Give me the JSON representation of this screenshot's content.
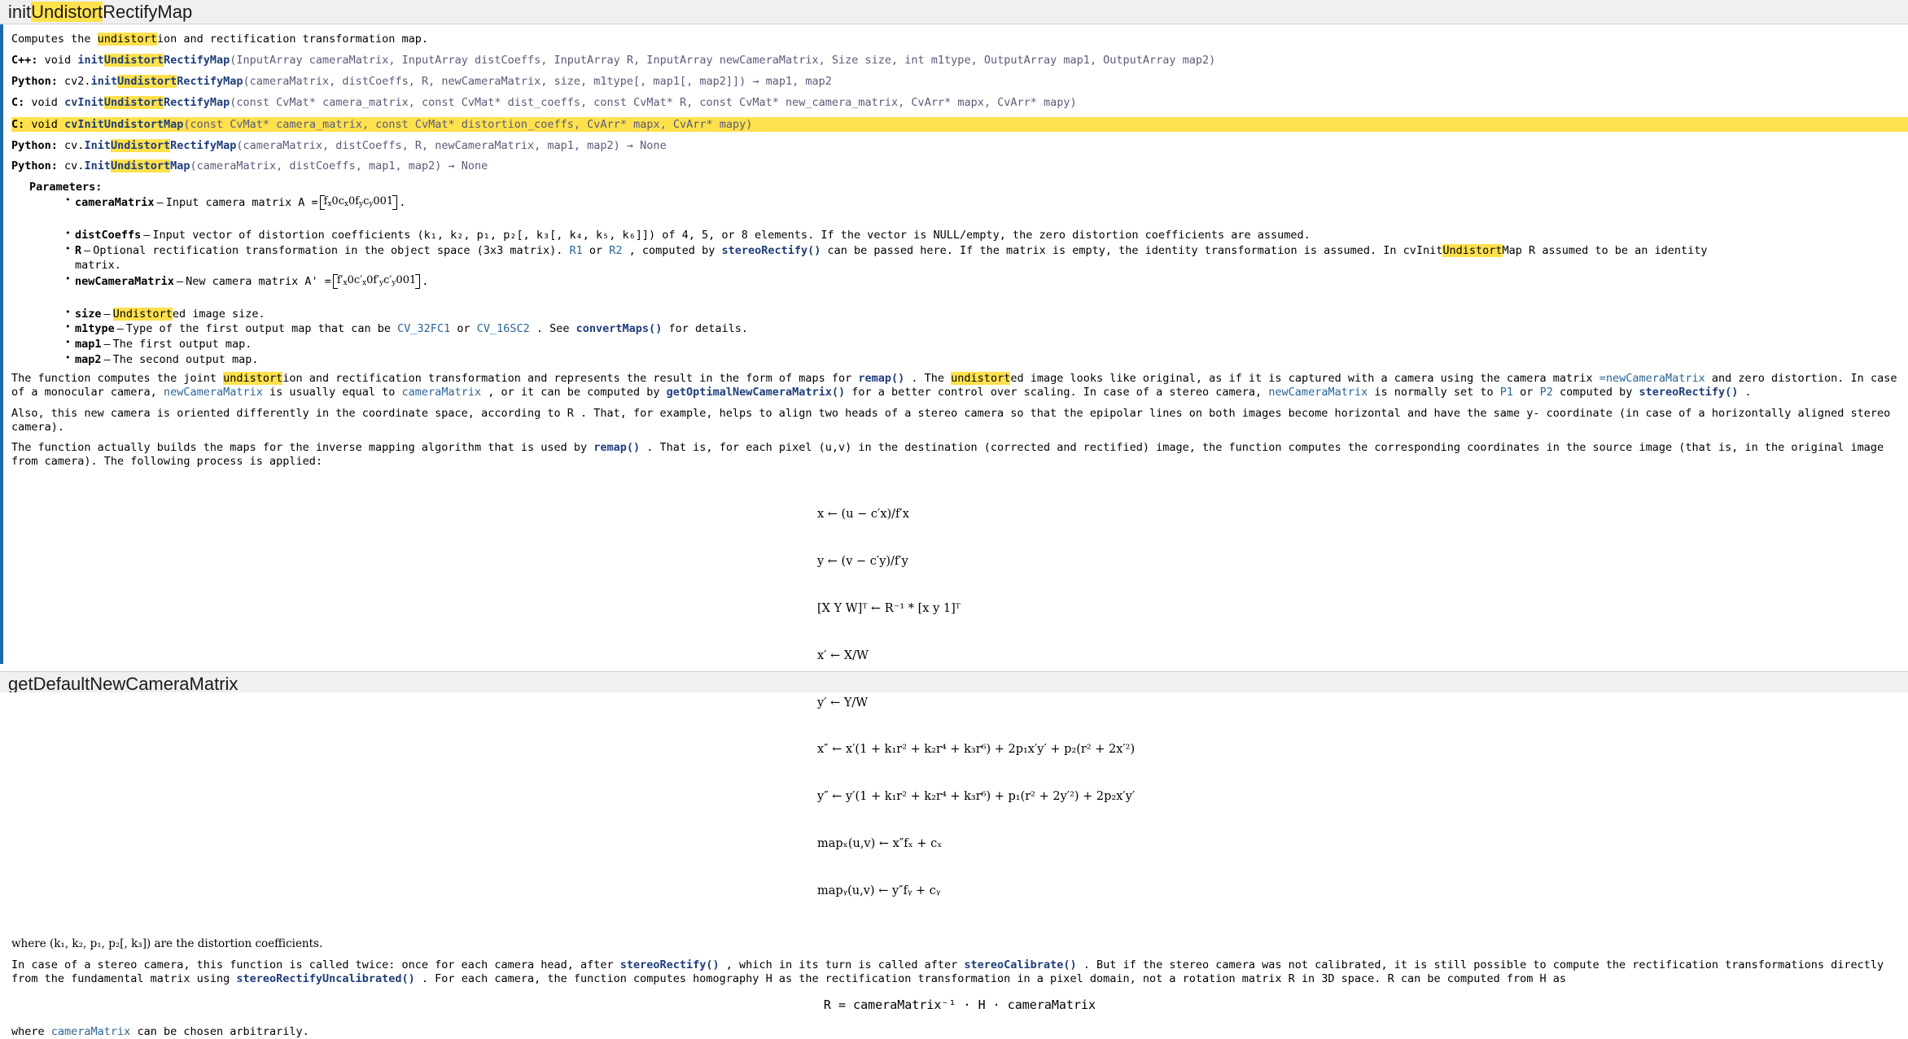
{
  "page": {
    "title": "initUndistortRectifyMap",
    "title_parts": [
      "init",
      "Undistort",
      "RectifyMap"
    ],
    "accent_color": "#1b6ca8",
    "highlight_color": "#ffe14d",
    "heading_bg": "#f0f0f0",
    "link_color": "#2a6496"
  },
  "summary": {
    "prefix": "Computes the ",
    "highlight": "undistort",
    "suffix": "ion and rectification transformation map."
  },
  "signatures": [
    {
      "lang": "C++:",
      "ret": "void",
      "fn_pre": "init",
      "fn_hl": "Undistort",
      "fn_post": "RectifyMap",
      "args": "(InputArray cameraMatrix, InputArray distCoeffs, InputArray R, InputArray newCameraMatrix, Size size, int m1type, OutputArray map1, OutputArray map2)",
      "highlighted": false
    },
    {
      "lang": "Python:",
      "ret": "cv2.",
      "fn_pre": "init",
      "fn_hl": "Undistort",
      "fn_post": "RectifyMap",
      "args": "(cameraMatrix, distCoeffs, R, newCameraMatrix, size, m1type[, map1[, map2]]) → map1, map2",
      "highlighted": false
    },
    {
      "lang": "C:",
      "ret": "void",
      "fn_pre": "cvInit",
      "fn_hl": "Undistort",
      "fn_post": "RectifyMap",
      "args": "(const CvMat* camera_matrix, const CvMat* dist_coeffs, const CvMat* R, const CvMat* new_camera_matrix, CvArr* mapx, CvArr* mapy)",
      "highlighted": false
    },
    {
      "lang": "C:",
      "ret": "void",
      "fn_pre": "cvInit",
      "fn_hl": "Undistort",
      "fn_post": "Map",
      "args": "(const CvMat* camera_matrix, const CvMat* distortion_coeffs, CvArr* mapx, CvArr* mapy)",
      "highlighted": true
    },
    {
      "lang": "Python:",
      "ret": "cv.",
      "fn_pre": "Init",
      "fn_hl": "Undistort",
      "fn_post": "RectifyMap",
      "args": "(cameraMatrix, distCoeffs, R, newCameraMatrix, map1, map2) → None",
      "highlighted": false
    },
    {
      "lang": "Python:",
      "ret": "cv.",
      "fn_pre": "Init",
      "fn_hl": "Undistort",
      "fn_post": "Map",
      "args": "(cameraMatrix, distCoeffs, map1, map2) → None",
      "highlighted": false
    }
  ],
  "parameters": {
    "label": "Parameters:",
    "items": [
      {
        "name": "cameraMatrix",
        "desc_pre": "Input camera matrix A =",
        "matrix": [
          "f",
          "0",
          "c",
          "0",
          "f",
          "c",
          "0",
          "0",
          "1"
        ],
        "desc_post": "."
      },
      {
        "name": "distCoeffs",
        "desc": "Input vector of distortion coefficients (k₁, k₂, p₁, p₂[, k₃[, k₄, k₅, k₆]]) of 4, 5, or 8 elements. If the vector is NULL/empty, the zero distortion coefficients are assumed."
      },
      {
        "name": "R",
        "desc": "Optional rectification transformation in the object space (3x3 matrix). R1 or R2 , computed by stereoRectify() can be passed here. If the matrix is empty, the identity transformation is assumed. In cvInitUndistortMap R assumed to be an identity matrix.",
        "refs": [
          "R1",
          "R2",
          "stereoRectify()"
        ]
      },
      {
        "name": "newCameraMatrix",
        "desc_pre": "New camera matrix A' =",
        "matrix_primed": true,
        "desc_post": "."
      },
      {
        "name": "size",
        "desc_hl": "Undistort",
        "desc": "ed image size."
      },
      {
        "name": "m1type",
        "desc": "Type of the first output map that can be CV_32FC1 or CV_16SC2 . See convertMaps() for details.",
        "refs": [
          "CV_32FC1",
          "CV_16SC2",
          "convertMaps()"
        ]
      },
      {
        "name": "map1",
        "desc": "The first output map."
      },
      {
        "name": "map2",
        "desc": "The second output map."
      }
    ]
  },
  "body": {
    "p1_a": "The function computes the joint ",
    "p1_hl": "undistort",
    "p1_b": "ion and rectification transformation and represents the result in the form of maps for ",
    "p1_ref1": "remap()",
    "p1_c": " . The ",
    "p1_hl2": "undistort",
    "p1_d": "ed image looks like original, as if it is captured with a camera using the camera matrix ",
    "p1_ref2": "=newCameraMatrix",
    "p1_e": " and zero distortion. In case of a monocular camera, ",
    "p1_m1": "newCameraMatrix",
    "p1_f": " is usually equal to ",
    "p1_m2": "cameraMatrix",
    "p1_g": " , or it can be computed by ",
    "p1_ref3": "getOptimalNewCameraMatrix()",
    "p1_h": " for a better control over scaling. In case of a stereo camera, ",
    "p1_m3": "newCameraMatrix",
    "p1_i": " is normally set to ",
    "p1_ref4": "P1",
    "p1_j": " or ",
    "p1_ref5": "P2",
    "p1_k": " computed by ",
    "p1_ref6": "stereoRectify()",
    "p1_l": " .",
    "p2": "Also, this new camera is oriented differently in the coordinate space, according to R . That, for example, helps to align two heads of a stereo camera so that the epipolar lines on both images become horizontal and have the same y- coordinate (in case of a horizontally aligned stereo camera).",
    "p3_a": "The function actually builds the maps for the inverse mapping algorithm that is used by ",
    "p3_ref": "remap()",
    "p3_b": " . That is, for each pixel (u,v) in the destination (corrected and rectified) image, the function computes the corresponding coordinates in the source image (that is, in the original image from camera). The following process is applied:",
    "p4_a": "where (k₁, k₂, p₁, p₂[, k₃]) are the distortion coefficients.",
    "p5_a": "In case of a stereo camera, this function is called twice: once for each camera head, after ",
    "p5_ref1": "stereoRectify()",
    "p5_b": " , which in its turn is called after ",
    "p5_ref2": "stereoCalibrate()",
    "p5_c": " . But if the stereo camera was not calibrated, it is still possible to compute the rectification transformations directly from the fundamental matrix using ",
    "p5_ref3": "stereoRectifyUncalibrated()",
    "p5_d": " . For each camera, the function computes homography H as the rectification transformation in a pixel domain, not a rotation matrix R in 3D space. R can be computed from H as",
    "final_formula": "R = cameraMatrix⁻¹ · H · cameraMatrix",
    "p6_a": "where ",
    "p6_ref": "cameraMatrix",
    "p6_b": " can be chosen arbitrarily."
  },
  "process_formula": [
    "x ← (u − c′x)/f′x",
    "y ← (v − c′y)/f′y",
    "[X Y W]ᵀ ← R⁻¹ * [x y 1]ᵀ",
    "x′ ← X/W",
    "y′ ← Y/W",
    "x″ ← x′(1 + k₁r² + k₂r⁴ + k₃r⁶) + 2p₁x′y′ + p₂(r² + 2x′²)",
    "y″ ← y′(1 + k₁r² + k₂r⁴ + k₃r⁶) + p₁(r² + 2y′²) + 2p₂x′y′",
    "mapₓ(u,v) ← x″fₓ + cₓ",
    "mapᵧ(u,v) ← y″fᵧ + cᵧ"
  ],
  "footer": {
    "title": "getDefaultNewCameraMatrix"
  }
}
